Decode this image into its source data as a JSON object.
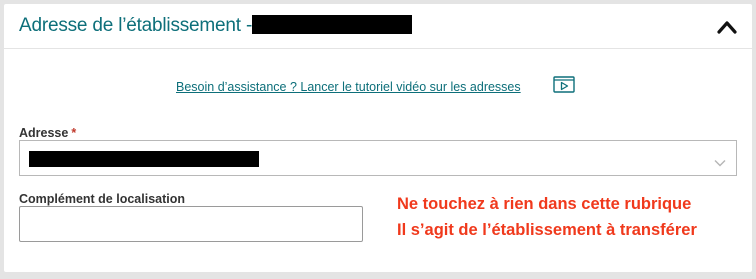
{
  "section": {
    "title": "Adresse de l’établissement -",
    "help_link": "Besoin d’assistance ? Lancer le tutoriel vidéo sur les adresses"
  },
  "fields": {
    "address": {
      "label": "Adresse",
      "required_marker": "*"
    },
    "location_complement": {
      "label": "Complément de localisation",
      "value": ""
    }
  },
  "annotation": {
    "line1": "Ne touchez à rien dans cette rubrique",
    "line2": "Il s’agit de l’établissement à transférer"
  },
  "icons": {
    "collapse": "chevron-up-icon",
    "video": "video-play-icon",
    "select": "chevron-down-icon"
  },
  "colors": {
    "brand_teal": "#0d6f7a",
    "annotation_red": "#f0391c",
    "required_red": "#c0392b"
  }
}
